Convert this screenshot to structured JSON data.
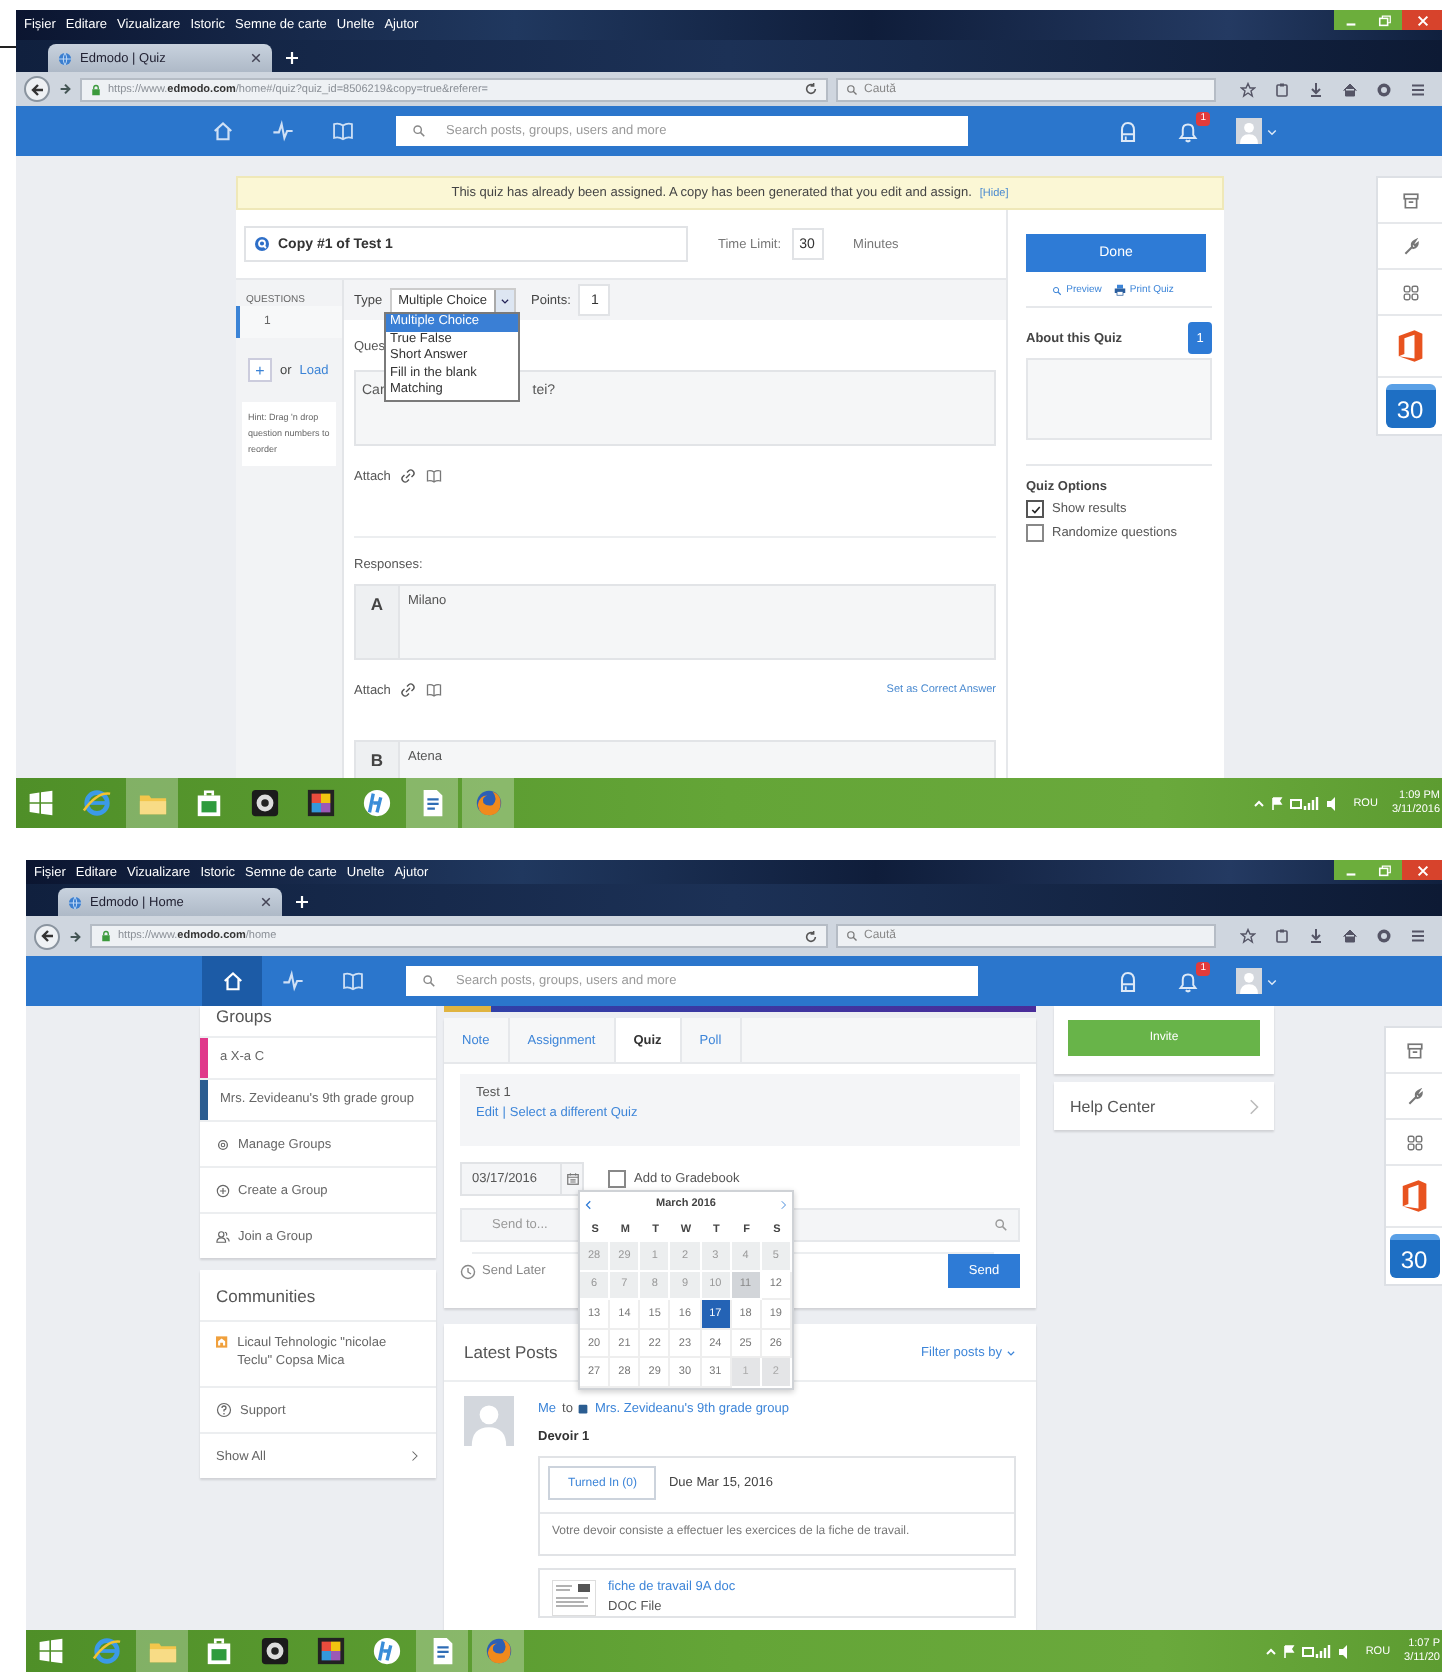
{
  "screens": [
    {
      "kind": "quiz",
      "browser": {
        "menu": [
          "Fișier",
          "Editare",
          "Vizualizare",
          "Istoric",
          "Semne de carte",
          "Unelte",
          "Ajutor"
        ],
        "tab": "Edmodo | Quiz",
        "url": "https://www.**edmodo.com**/home#/quiz?quiz_id=8506219&copy=true&referer=",
        "search_placeholder": "Caută"
      },
      "nav": {
        "items": [
          {
            "kind": "home",
            "selected": false
          },
          {
            "kind": "pulse",
            "selected": false
          },
          {
            "kind": "book",
            "selected": false
          }
        ],
        "search_placeholder": "Search posts, groups, users and more",
        "notifications": "1"
      },
      "quiz": {
        "notice": "This quiz has already been assigned. A copy has been generated that you edit and assign.",
        "hide_link": "[Hide]",
        "title": "Copy #1 of Test 1",
        "time_limit_label": "Time Limit:",
        "time_limit": "30",
        "minutes_label": "Minutes",
        "questions_heading": "QUESTIONS",
        "questions": [
          {
            "number": "1",
            "selected": true
          }
        ],
        "add": "+",
        "or": "or",
        "load": "Load",
        "hint": "Hint: Drag 'n drop question numbers to reorder",
        "type_label": "Type",
        "type_value": "Multiple Choice",
        "type_open": true,
        "type_options": [
          {
            "label": "Multiple Choice",
            "selected": true
          },
          {
            "label": "True False",
            "selected": false
          },
          {
            "label": "Short Answer",
            "selected": false
          },
          {
            "label": "Fill in the blank",
            "selected": false
          },
          {
            "label": "Matching",
            "selected": false
          }
        ],
        "points_label": "Points:",
        "points": "1",
        "question_label": "Ques",
        "question_text_start": "Car",
        "question_text_end": "tei?",
        "attach_label": "Attach",
        "responses_label": "Responses:",
        "responses": [
          {
            "letter": "A",
            "text": "Milano",
            "attach": "Attach",
            "correct_link": "Set as Correct Answer"
          },
          {
            "letter": "B",
            "text": "Atena"
          }
        ],
        "done": "Done",
        "preview": "Preview",
        "print": "Print Quiz",
        "about_heading": "About this Quiz",
        "about_count": "1",
        "options_heading": "Quiz Options",
        "options": [
          {
            "label": "Show results",
            "checked": true
          },
          {
            "label": "Randomize questions",
            "checked": false
          }
        ]
      },
      "dock": {
        "calendar_day": "30"
      },
      "taskbar": {
        "apps": [
          {
            "kind": "ie",
            "active": false
          },
          {
            "kind": "explorer",
            "active": true
          },
          {
            "kind": "store",
            "active": false
          },
          {
            "kind": "webcam",
            "active": false
          },
          {
            "kind": "photos",
            "active": false
          },
          {
            "kind": "hp",
            "active": false
          },
          {
            "kind": "document",
            "active": true
          },
          {
            "kind": "firefox",
            "active": true
          }
        ],
        "language": "ROU",
        "time": "1:09 PM",
        "date": "3/11/2016"
      }
    },
    {
      "kind": "home",
      "browser": {
        "menu": [
          "Fișier",
          "Editare",
          "Vizualizare",
          "Istoric",
          "Semne de carte",
          "Unelte",
          "Ajutor"
        ],
        "tab": "Edmodo | Home",
        "url": "https://www.**edmodo.com**/home",
        "search_placeholder": "Caută"
      },
      "nav": {
        "items": [
          {
            "kind": "home",
            "selected": true
          },
          {
            "kind": "pulse",
            "selected": false
          },
          {
            "kind": "book",
            "selected": false
          }
        ],
        "search_placeholder": "Search posts, groups, users and more",
        "notifications": "1"
      },
      "home": {
        "groups_heading": "Groups",
        "groups": [
          {
            "name": "a X-a C",
            "color": "#e0388a"
          },
          {
            "name": "Mrs. Zevideanu's 9th grade group",
            "color": "#2b5d91"
          }
        ],
        "group_actions": [
          {
            "kind": "manage",
            "label": "Manage Groups"
          },
          {
            "kind": "create",
            "label": "Create a Group"
          },
          {
            "kind": "join",
            "label": "Join a Group"
          }
        ],
        "communities_heading": "Communities",
        "communities": [
          {
            "name": "Licaul Tehnologic \"nicolae Teclu\" Copsa Mica"
          }
        ],
        "support": "Support",
        "show_all": "Show All",
        "composer_tabs": [
          {
            "label": "Note",
            "selected": false
          },
          {
            "label": "Assignment",
            "selected": false
          },
          {
            "label": "Quiz",
            "selected": true
          },
          {
            "label": "Poll",
            "selected": false
          }
        ],
        "quiz_name": "Test 1",
        "edit_link": "Edit",
        "separator": "|",
        "select_link": "Select a different Quiz",
        "date": "03/17/2016",
        "gradebook": {
          "label": "Add to Gradebook",
          "checked": false
        },
        "send_to_placeholder": "Send to...",
        "send_later": "Send Later",
        "send": "Send",
        "calendar": {
          "month": "March 2016",
          "weekdays": [
            "S",
            "M",
            "T",
            "W",
            "T",
            "F",
            "S"
          ],
          "days": [
            {
              "label": "28",
              "kind": "past",
              "selected": false
            },
            {
              "label": "29",
              "kind": "past",
              "selected": false
            },
            {
              "label": "1",
              "kind": "past",
              "selected": false
            },
            {
              "label": "2",
              "kind": "past",
              "selected": false
            },
            {
              "label": "3",
              "kind": "past",
              "selected": false
            },
            {
              "label": "4",
              "kind": "past",
              "selected": false
            },
            {
              "label": "5",
              "kind": "past",
              "selected": false
            },
            {
              "label": "6",
              "kind": "past",
              "selected": false
            },
            {
              "label": "7",
              "kind": "past",
              "selected": false
            },
            {
              "label": "8",
              "kind": "past",
              "selected": false
            },
            {
              "label": "9",
              "kind": "past",
              "selected": false
            },
            {
              "label": "10",
              "kind": "past",
              "selected": false
            },
            {
              "label": "11",
              "kind": "today",
              "selected": false
            },
            {
              "label": "12",
              "kind": "current",
              "selected": false
            },
            {
              "label": "13",
              "kind": "current",
              "selected": false
            },
            {
              "label": "14",
              "kind": "current",
              "selected": false
            },
            {
              "label": "15",
              "kind": "current",
              "selected": false
            },
            {
              "label": "16",
              "kind": "current",
              "selected": false
            },
            {
              "label": "17",
              "kind": "current",
              "selected": true
            },
            {
              "label": "18",
              "kind": "current",
              "selected": false
            },
            {
              "label": "19",
              "kind": "current",
              "selected": false
            },
            {
              "label": "20",
              "kind": "current",
              "selected": false
            },
            {
              "label": "21",
              "kind": "current",
              "selected": false
            },
            {
              "label": "22",
              "kind": "current",
              "selected": false
            },
            {
              "label": "23",
              "kind": "current",
              "selected": false
            },
            {
              "label": "24",
              "kind": "current",
              "selected": false
            },
            {
              "label": "25",
              "kind": "current",
              "selected": false
            },
            {
              "label": "26",
              "kind": "current",
              "selected": false
            },
            {
              "label": "27",
              "kind": "current",
              "selected": false
            },
            {
              "label": "28",
              "kind": "current",
              "selected": false
            },
            {
              "label": "29",
              "kind": "current",
              "selected": false
            },
            {
              "label": "30",
              "kind": "current",
              "selected": false
            },
            {
              "label": "31",
              "kind": "current",
              "selected": false
            },
            {
              "label": "1",
              "kind": "next",
              "selected": false
            },
            {
              "label": "2",
              "kind": "next",
              "selected": false
            }
          ]
        },
        "latest_heading": "Latest Posts",
        "filter": "Filter posts by",
        "post": {
          "author": "Me",
          "to": "to",
          "group": "Mrs. Zevideanu's 9th grade group",
          "title": "Devoir 1",
          "turned_in": "Turned In (0)",
          "due": "Due Mar 15, 2016",
          "body": "Votre devoir consiste a effectuer les exercices de la fiche de travail.",
          "file_name": "fiche de travail 9A doc",
          "file_type": "DOC File"
        },
        "invite": "Invite",
        "help": "Help Center"
      },
      "dock": {
        "calendar_day": "30"
      },
      "taskbar": {
        "apps": [
          {
            "kind": "ie",
            "active": false
          },
          {
            "kind": "explorer",
            "active": true
          },
          {
            "kind": "store",
            "active": false
          },
          {
            "kind": "webcam",
            "active": false
          },
          {
            "kind": "photos",
            "active": false
          },
          {
            "kind": "hp",
            "active": false
          },
          {
            "kind": "document",
            "active": true
          },
          {
            "kind": "firefox",
            "active": true
          }
        ],
        "language": "ROU",
        "time": "1:07 P",
        "date": "3/11/20"
      }
    }
  ]
}
